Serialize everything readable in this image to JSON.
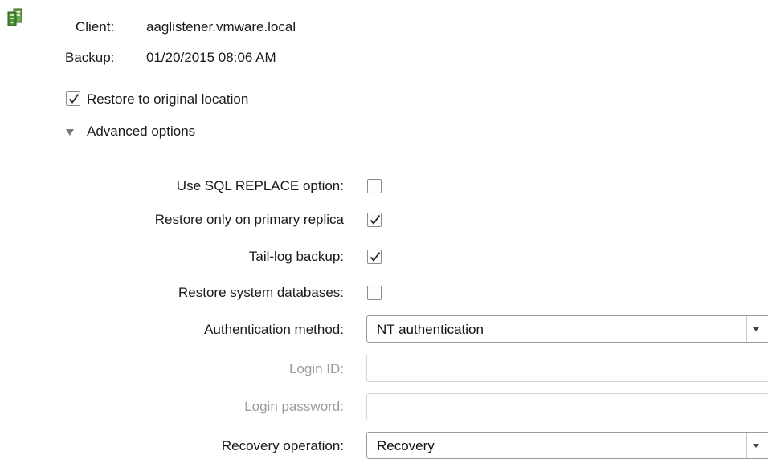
{
  "summary": {
    "client_label": "Client:",
    "client_value": "aaglistener.vmware.local",
    "backup_label": "Backup:",
    "backup_value": "01/20/2015 08:06 AM"
  },
  "restore_original": {
    "label": "Restore to original location",
    "checked": true
  },
  "advanced": {
    "label": "Advanced options",
    "expanded": true
  },
  "options": {
    "sql_replace": {
      "label": "Use SQL REPLACE option:",
      "checked": false
    },
    "primary_replica": {
      "label": "Restore only on primary replica",
      "checked": true
    },
    "tail_log": {
      "label": "Tail-log backup:",
      "checked": true
    },
    "system_db": {
      "label": "Restore system databases:",
      "checked": false
    },
    "auth_method": {
      "label": "Authentication method:",
      "value": "NT authentication"
    },
    "login_id": {
      "label": "Login ID:",
      "value": ""
    },
    "login_password": {
      "label": "Login password:",
      "value": ""
    },
    "recovery_op": {
      "label": "Recovery operation:",
      "value": "Recovery"
    }
  },
  "icons": {
    "server": "server-cluster-icon",
    "check": "checkmark-icon",
    "expand": "triangle-down-icon",
    "dropdown": "caret-down-icon"
  },
  "colors": {
    "icon_green": "#3f8f2e",
    "disabled_text": "#9a9a9a"
  }
}
